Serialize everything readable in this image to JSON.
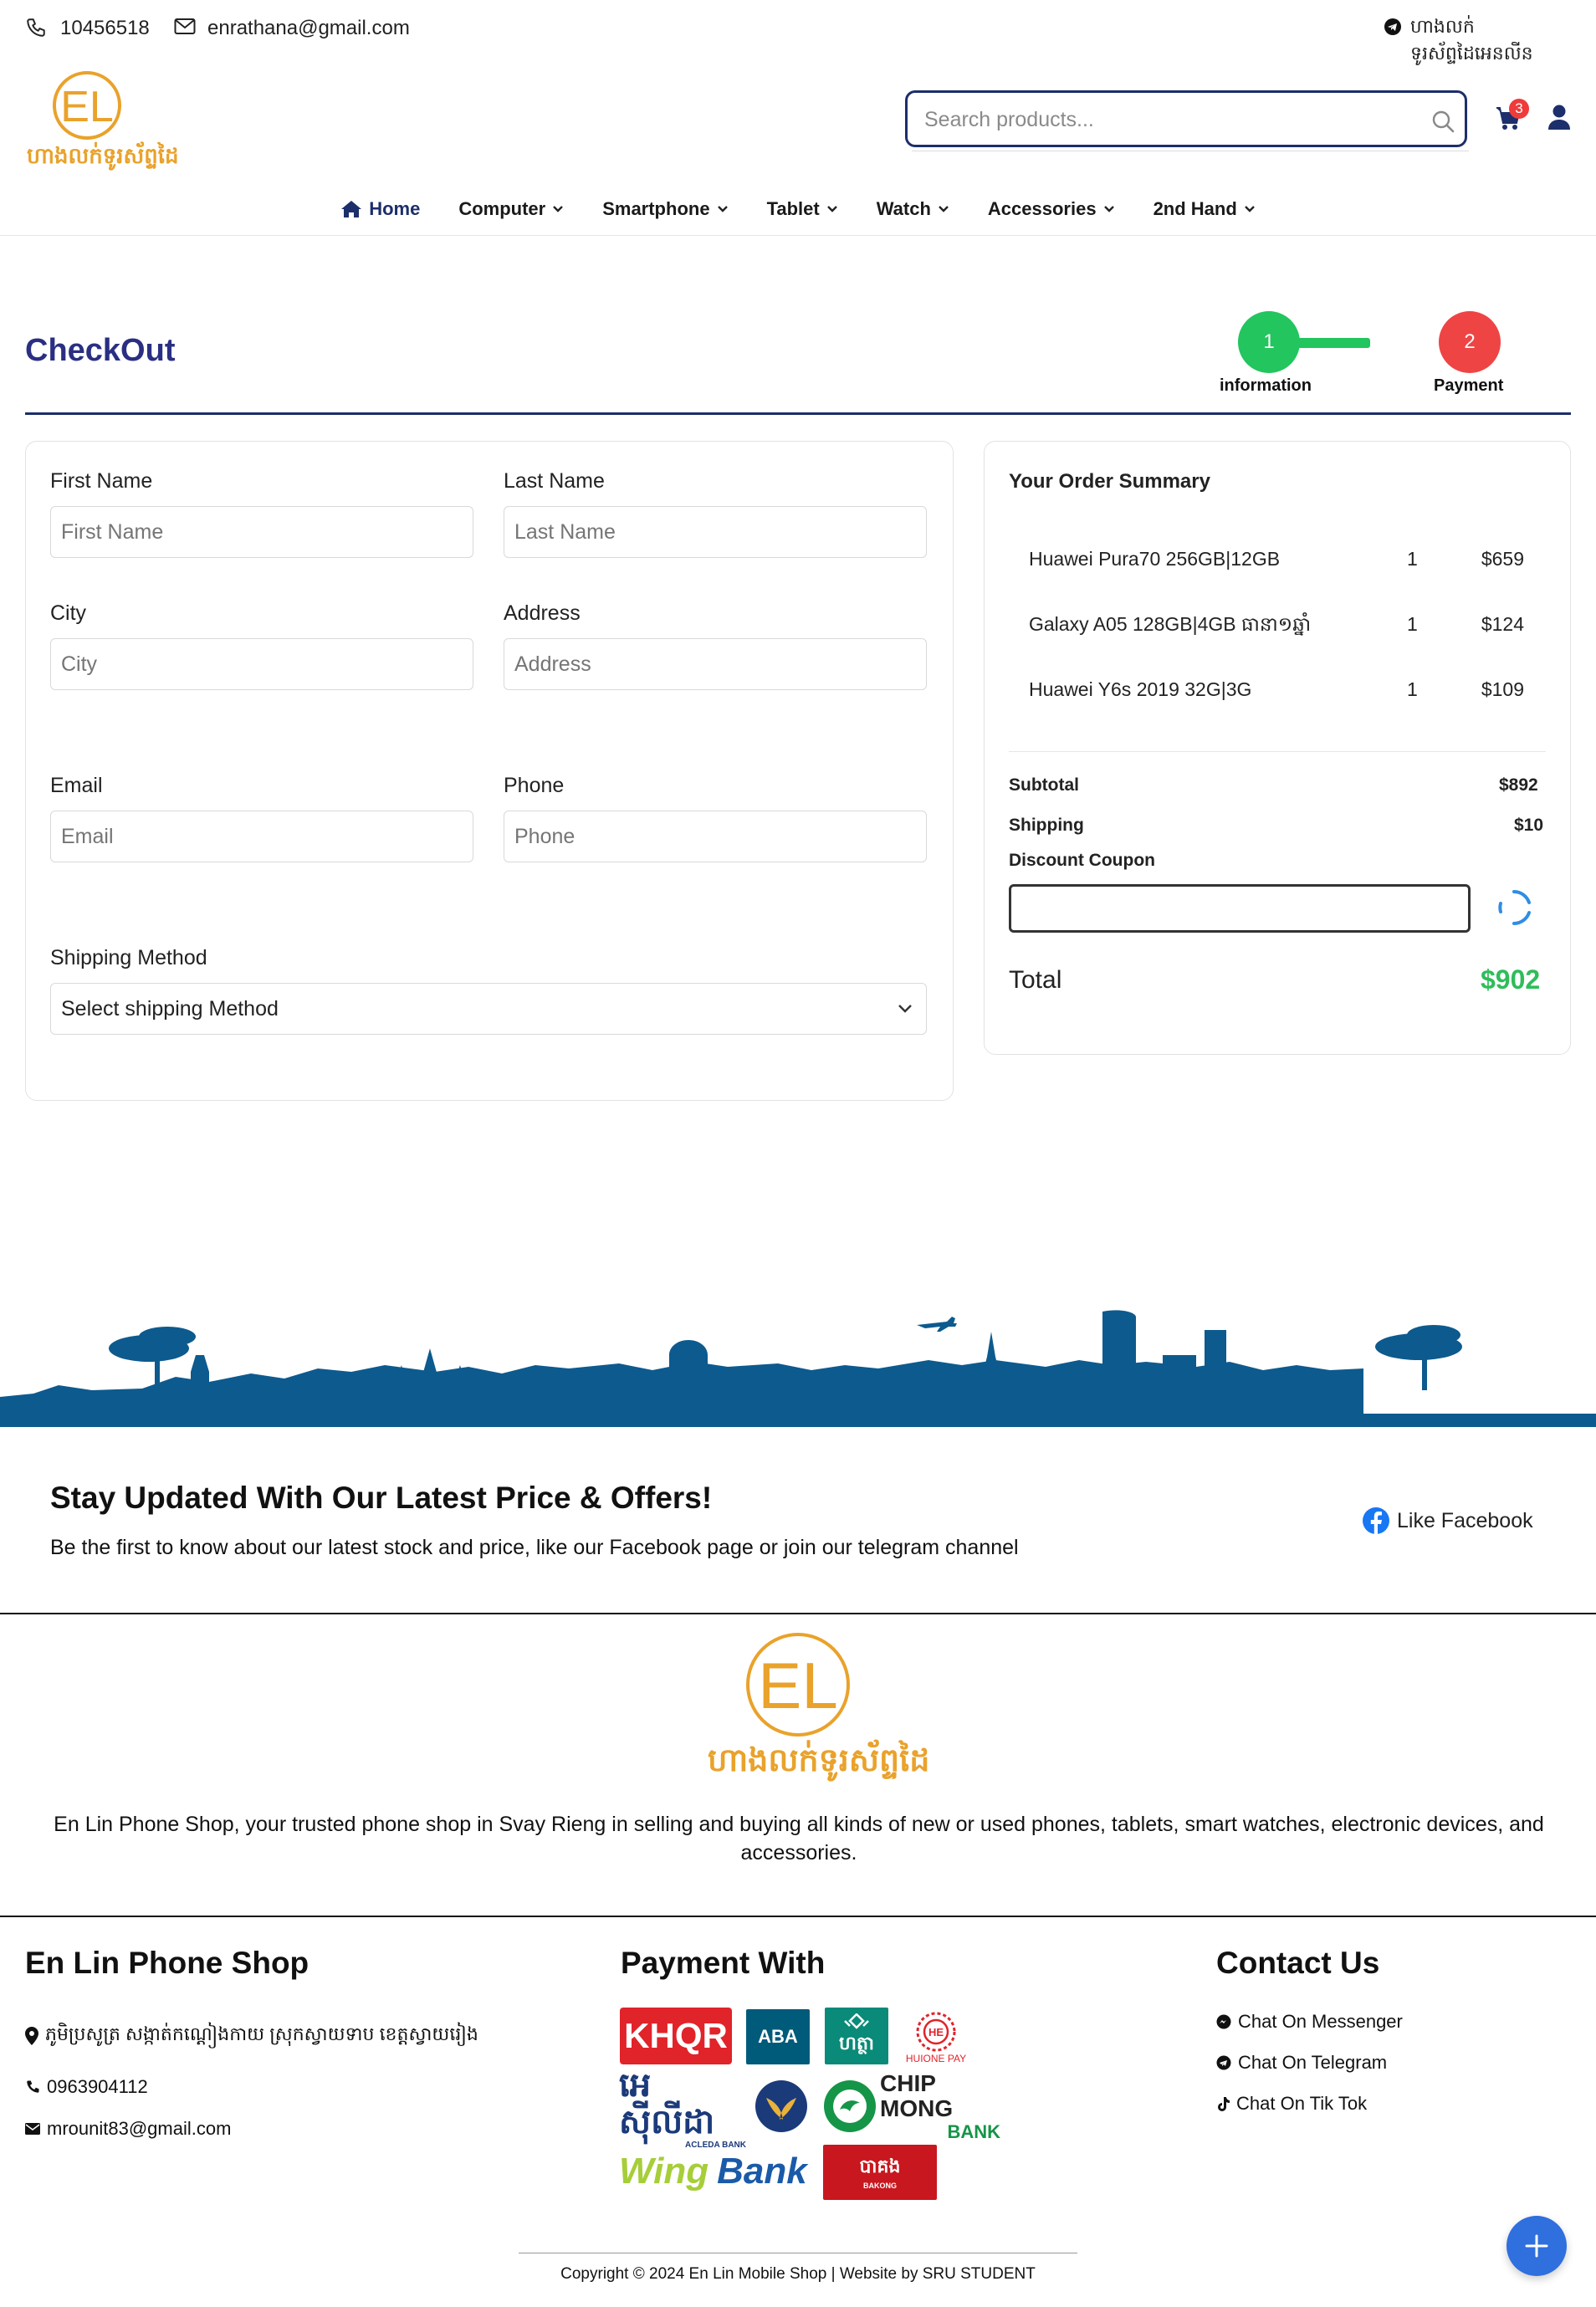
{
  "topbar": {
    "phone": "10456518",
    "email": "enrathana@gmail.com",
    "telegram_text": "ហាងលក់ទូរស័ព្ទដៃអេនលីន"
  },
  "brand": {
    "logo_letters": "EL",
    "logo_khmer": "ហាងលក់ទូរស័ព្ទដៃ",
    "color": "#e9a22b"
  },
  "search": {
    "placeholder": "Search products..."
  },
  "cart": {
    "count": "3"
  },
  "nav": {
    "items": [
      {
        "label": "Home",
        "active": true
      },
      {
        "label": "Computer"
      },
      {
        "label": "Smartphone"
      },
      {
        "label": "Tablet"
      },
      {
        "label": "Watch"
      },
      {
        "label": "Accessories"
      },
      {
        "label": "2nd Hand"
      }
    ]
  },
  "checkout": {
    "title": "CheckOut",
    "steps": [
      {
        "number": "1",
        "label": "information",
        "color": "#22c55e"
      },
      {
        "number": "2",
        "label": "Payment",
        "color": "#ef4444"
      }
    ]
  },
  "form": {
    "first_name": {
      "label": "First Name",
      "placeholder": "First Name"
    },
    "last_name": {
      "label": "Last Name",
      "placeholder": "Last Name"
    },
    "city": {
      "label": "City",
      "placeholder": "City"
    },
    "address": {
      "label": "Address",
      "placeholder": "Address"
    },
    "email": {
      "label": "Email",
      "placeholder": "Email"
    },
    "phone": {
      "label": "Phone",
      "placeholder": "Phone"
    },
    "shipping": {
      "label": "Shipping Method",
      "value": "Select shipping Method"
    }
  },
  "summary": {
    "title": "Your Order Summary",
    "items": [
      {
        "name": "Huawei Pura70 256GB|12GB",
        "qty": "1",
        "price": "$659"
      },
      {
        "name": "Galaxy A05 128GB|4GB ធានា១ឆ្នាំ",
        "qty": "1",
        "price": "$124"
      },
      {
        "name": "Huawei Y6s 2019 32G|3G",
        "qty": "1",
        "price": "$109"
      }
    ],
    "subtotal_label": "Subtotal",
    "subtotal": "$892",
    "shipping_label": "Shipping",
    "shipping": "$10",
    "coupon_label": "Discount Coupon",
    "total_label": "Total",
    "total": "$902"
  },
  "newsletter": {
    "title": "Stay Updated With Our Latest Price & Offers!",
    "subtitle": "Be the first to know about our latest stock and price, like our Facebook page or join our telegram channel",
    "facebook": "Like Facebook"
  },
  "about": {
    "text": "En Lin Phone Shop, your trusted phone shop in Svay Rieng in selling and buying all kinds of new or used phones, tablets, smart watches, electronic devices, and accessories."
  },
  "footer": {
    "shop": {
      "title": "En Lin Phone Shop",
      "address": "ភូមិប្រសូត្រ សង្កាត់កណ្ដៀងកាយ ស្រុកស្វាយទាប ខេត្តស្វាយរៀង",
      "phone": "0963904112",
      "email": "mrounit83@gmail.com"
    },
    "payment": {
      "title": "Payment With",
      "logos": [
        {
          "name": "KHQR",
          "text": "KHQR"
        },
        {
          "name": "ABA",
          "text": "ABA"
        },
        {
          "name": "Hattha Bank",
          "text": "ហត្ថា"
        },
        {
          "name": "Huione Pay",
          "text": "HUIONE PAY"
        },
        {
          "name": "Acleda Bank",
          "text": "អេស៊ីលីដា",
          "sub": "ACLEDA BANK"
        },
        {
          "name": "Chip Mong Bank",
          "text": "CHIP MONG",
          "sub": "BANK"
        },
        {
          "name": "Wing Bank",
          "text": "Wing",
          "sub": "Bank"
        },
        {
          "name": "Bakong",
          "text": "បាគង",
          "sub": "BAKONG"
        }
      ]
    },
    "contact": {
      "title": "Contact Us",
      "items": [
        "Chat On Messenger",
        "Chat On Telegram",
        "Chat On Tik Tok"
      ]
    },
    "copyright": "Copyright © 2024 En Lin Mobile Shop | Website by SRU STUDENT"
  }
}
